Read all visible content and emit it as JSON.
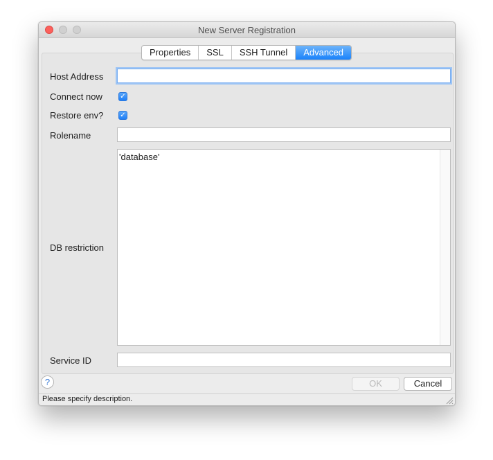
{
  "window": {
    "title": "New Server Registration"
  },
  "tabs": [
    {
      "label": "Properties",
      "active": false
    },
    {
      "label": "SSL",
      "active": false
    },
    {
      "label": "SSH Tunnel",
      "active": false
    },
    {
      "label": "Advanced",
      "active": true
    }
  ],
  "form": {
    "host_address": {
      "label": "Host Address",
      "value": ""
    },
    "connect_now": {
      "label": "Connect now",
      "checked": true
    },
    "restore_env": {
      "label": "Restore env?",
      "checked": true
    },
    "rolename": {
      "label": "Rolename",
      "value": ""
    },
    "db_restriction": {
      "label": "DB restriction",
      "value": "'database'"
    },
    "service_id": {
      "label": "Service ID",
      "value": ""
    }
  },
  "buttons": {
    "help": "?",
    "ok": "OK",
    "cancel": "Cancel"
  },
  "status": {
    "text": "Please specify description."
  },
  "icons": {
    "check": "✓"
  },
  "colors": {
    "accent": "#1a82fb",
    "close": "#fc605c"
  }
}
